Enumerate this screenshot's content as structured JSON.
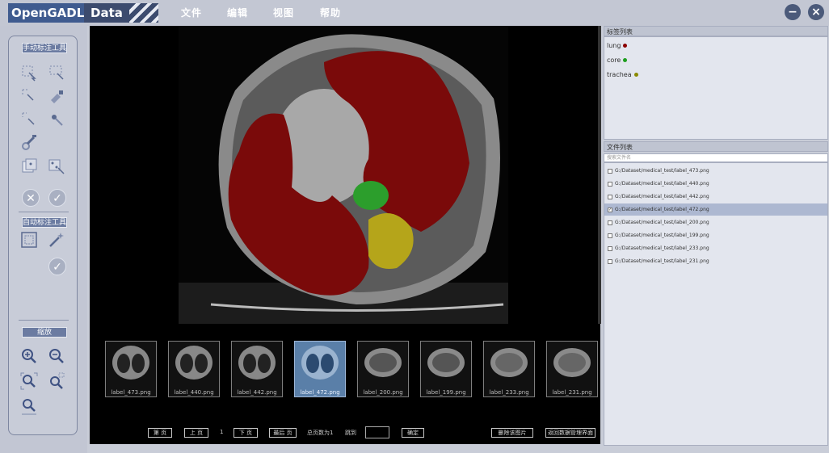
{
  "app": {
    "brand": "OpenGADL",
    "brand_suffix": "Data"
  },
  "menu": [
    "文件",
    "编辑",
    "视图",
    "帮助"
  ],
  "window_buttons": {
    "minimize": "−",
    "close": "×"
  },
  "toolbox": {
    "manual_title": "手动标注工具",
    "auto_title": "自动标注工具",
    "zoom_title": "缩放",
    "cancel_symbol": "✕",
    "confirm_symbol": "✓",
    "icons": {
      "manual": [
        "polygon-select-icon",
        "rect-select-icon",
        "point-select-icon",
        "brush-select-icon",
        "lasso-select-icon",
        "pen-tool-icon",
        "eraser-icon",
        "dice-icon",
        "grid-dice-icon"
      ],
      "auto": [
        "auto-region-icon",
        "magic-wand-icon"
      ],
      "zoom": [
        "zoom-in-icon",
        "zoom-out-icon",
        "zoom-fit-icon",
        "zoom-selection-icon",
        "zoom-reset-icon"
      ]
    }
  },
  "thumbnails": [
    {
      "label": "label_473.png",
      "selected": false
    },
    {
      "label": "label_440.png",
      "selected": false
    },
    {
      "label": "label_442.png",
      "selected": false
    },
    {
      "label": "label_472.png",
      "selected": true
    },
    {
      "label": "label_200.png",
      "selected": false
    },
    {
      "label": "label_199.png",
      "selected": false
    },
    {
      "label": "label_233.png",
      "selected": false
    },
    {
      "label": "label_231.png",
      "selected": false
    }
  ],
  "pager": {
    "first": "第 页",
    "prev": "上 页",
    "current": "1",
    "next": "下 页",
    "last": "最后 页",
    "total": "总页数为1",
    "goto": "跳到",
    "confirm": "确定",
    "delete_btn": "删除该图片",
    "back_btn": "返回数据管理界面"
  },
  "labels_panel": {
    "title": "标签列表",
    "items": [
      {
        "name": "lung",
        "color": "#8b0000"
      },
      {
        "name": "core",
        "color": "#1e9e1e"
      },
      {
        "name": "trachea",
        "color": "#8a8a00"
      }
    ]
  },
  "files_panel": {
    "title": "文件列表",
    "search_placeholder": "搜索文件名",
    "files": [
      {
        "path": "G:/Dataset/medical_test/label_473.png",
        "checked": false,
        "selected": false
      },
      {
        "path": "G:/Dataset/medical_test/label_440.png",
        "checked": false,
        "selected": false
      },
      {
        "path": "G:/Dataset/medical_test/label_442.png",
        "checked": false,
        "selected": false
      },
      {
        "path": "G:/Dataset/medical_test/label_472.png",
        "checked": true,
        "selected": true
      },
      {
        "path": "G:/Dataset/medical_test/label_200.png",
        "checked": false,
        "selected": false
      },
      {
        "path": "G:/Dataset/medical_test/label_199.png",
        "checked": false,
        "selected": false
      },
      {
        "path": "G:/Dataset/medical_test/label_233.png",
        "checked": false,
        "selected": false
      },
      {
        "path": "G:/Dataset/medical_test/label_231.png",
        "checked": false,
        "selected": false
      }
    ]
  },
  "colors": {
    "lung": "#7a0a0a",
    "core": "#2c9e2c",
    "trachea": "#b5a51a",
    "accent": "#4a5f8c"
  }
}
